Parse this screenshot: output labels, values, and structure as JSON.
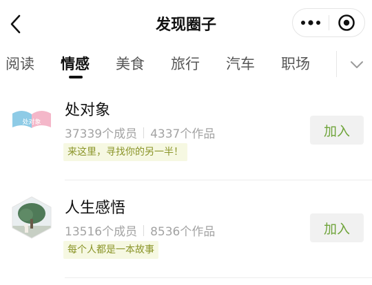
{
  "nav": {
    "title": "发现圈子",
    "back_icon": "chevron-left-icon",
    "more_icon": "more-dots-icon",
    "close_icon": "target-close-icon"
  },
  "tabs": [
    {
      "label": "阅读",
      "active": false
    },
    {
      "label": "情感",
      "active": true
    },
    {
      "label": "美食",
      "active": false
    },
    {
      "label": "旅行",
      "active": false
    },
    {
      "label": "汽车",
      "active": false
    },
    {
      "label": "职场",
      "active": false
    }
  ],
  "tabs_toggle_icon": "chevron-down-icon",
  "circles": [
    {
      "name": "处对象",
      "members": "37339个成员",
      "works": "4337个作品",
      "tag": "来这里，寻找你的另一半！",
      "join_label": "加入",
      "avatar_text": "处对象"
    },
    {
      "name": "人生感悟",
      "members": "13516个成员",
      "works": "8536个作品",
      "tag": "每个人都是一本故事",
      "join_label": "加入"
    }
  ],
  "colors": {
    "accent_green": "#6fa43a",
    "tag_text": "#8a9428",
    "tag_bg": "#f6f8e2"
  }
}
